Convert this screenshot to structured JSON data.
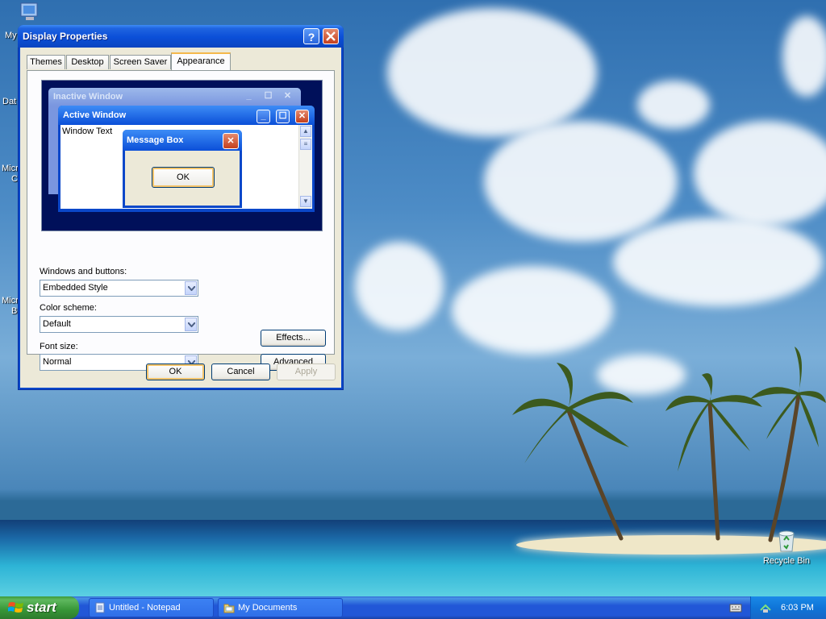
{
  "desktop": {
    "icons": {
      "recycle_bin": "Recycle Bin",
      "my_prefix": "My",
      "dat_prefix": "Dat",
      "micr_prefix_1": "Micr",
      "micr_c": "C",
      "micr_prefix_2": "Micr",
      "micr_b": "B"
    }
  },
  "window": {
    "title": "Display Properties",
    "help_label": "?",
    "close_label": "✕",
    "tabs": [
      {
        "label": "Themes"
      },
      {
        "label": "Desktop"
      },
      {
        "label": "Screen Saver"
      },
      {
        "label": "Appearance"
      }
    ],
    "preview": {
      "inactive_title": "Inactive Window",
      "active_title": "Active Window",
      "window_text": "Window Text",
      "message_title": "Message Box",
      "ok_label": "OK"
    },
    "fields": {
      "windows_buttons_label": "Windows and buttons:",
      "windows_buttons_value": "Embedded Style",
      "color_scheme_label": "Color scheme:",
      "color_scheme_value": "Default",
      "font_size_label": "Font size:",
      "font_size_value": "Normal"
    },
    "buttons": {
      "effects": "Effects...",
      "advanced": "Advanced",
      "ok": "OK",
      "cancel": "Cancel",
      "apply": "Apply"
    }
  },
  "taskbar": {
    "start_label": "start",
    "items": [
      {
        "label": "Untitled - Notepad"
      },
      {
        "label": "My Documents"
      }
    ],
    "clock": "6:03 PM"
  },
  "colors": {
    "title_blue": "#0b4fd8",
    "close_red": "#c4401e",
    "dialog_face": "#ece9d8",
    "start_green": "#379637"
  }
}
